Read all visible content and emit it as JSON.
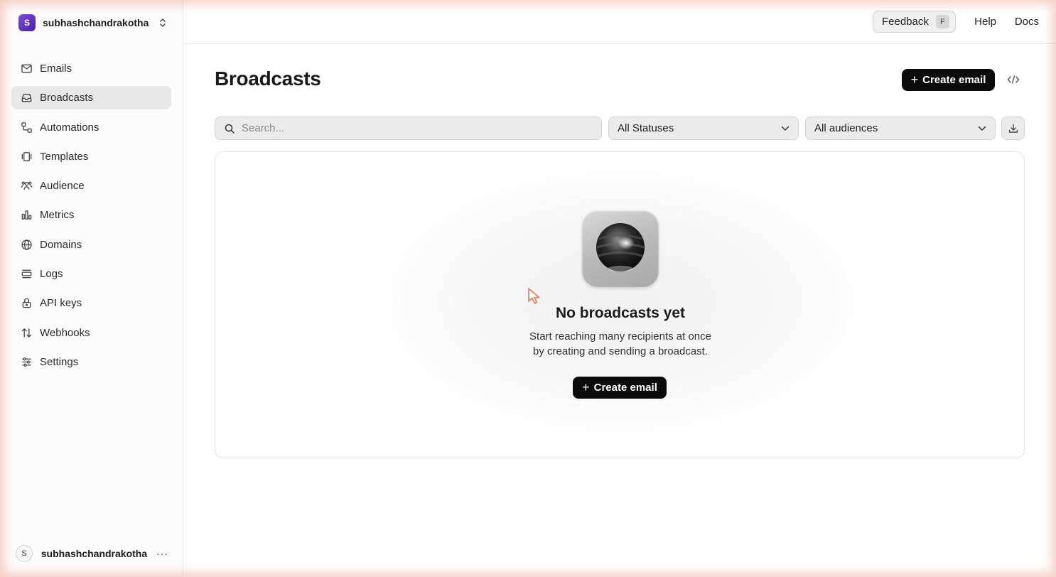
{
  "sidebar": {
    "team": {
      "avatar_letter": "S",
      "name": "subhashchandrakotha"
    },
    "items": [
      {
        "label": "Emails",
        "icon": "mail-icon"
      },
      {
        "label": "Broadcasts",
        "icon": "inbox-icon",
        "active": true
      },
      {
        "label": "Automations",
        "icon": "workflow-icon"
      },
      {
        "label": "Templates",
        "icon": "templates-icon"
      },
      {
        "label": "Audience",
        "icon": "users-icon"
      },
      {
        "label": "Metrics",
        "icon": "bar-chart-icon"
      },
      {
        "label": "Domains",
        "icon": "globe-icon"
      },
      {
        "label": "Logs",
        "icon": "logs-icon"
      },
      {
        "label": "API keys",
        "icon": "lock-icon"
      },
      {
        "label": "Webhooks",
        "icon": "arrows-icon"
      },
      {
        "label": "Settings",
        "icon": "sliders-icon"
      }
    ],
    "user": {
      "avatar_letter": "S",
      "name": "subhashchandrakotha",
      "more": "···"
    }
  },
  "topbar": {
    "feedback_label": "Feedback",
    "feedback_shortcut": "F",
    "help_label": "Help",
    "docs_label": "Docs"
  },
  "main": {
    "title": "Broadcasts",
    "create_label": "Create email",
    "search": {
      "placeholder": "Search...",
      "value": ""
    },
    "status_filter": "All Statuses",
    "audience_filter": "All audiences",
    "empty": {
      "title": "No broadcasts yet",
      "line1": "Start reaching many recipients at once",
      "line2": "by creating and sending a broadcast.",
      "button_label": "Create email"
    }
  },
  "colors": {
    "accent": "#0b0b0b",
    "team_avatar": "#5a2bbf",
    "active_nav": "#e8e8e8"
  }
}
